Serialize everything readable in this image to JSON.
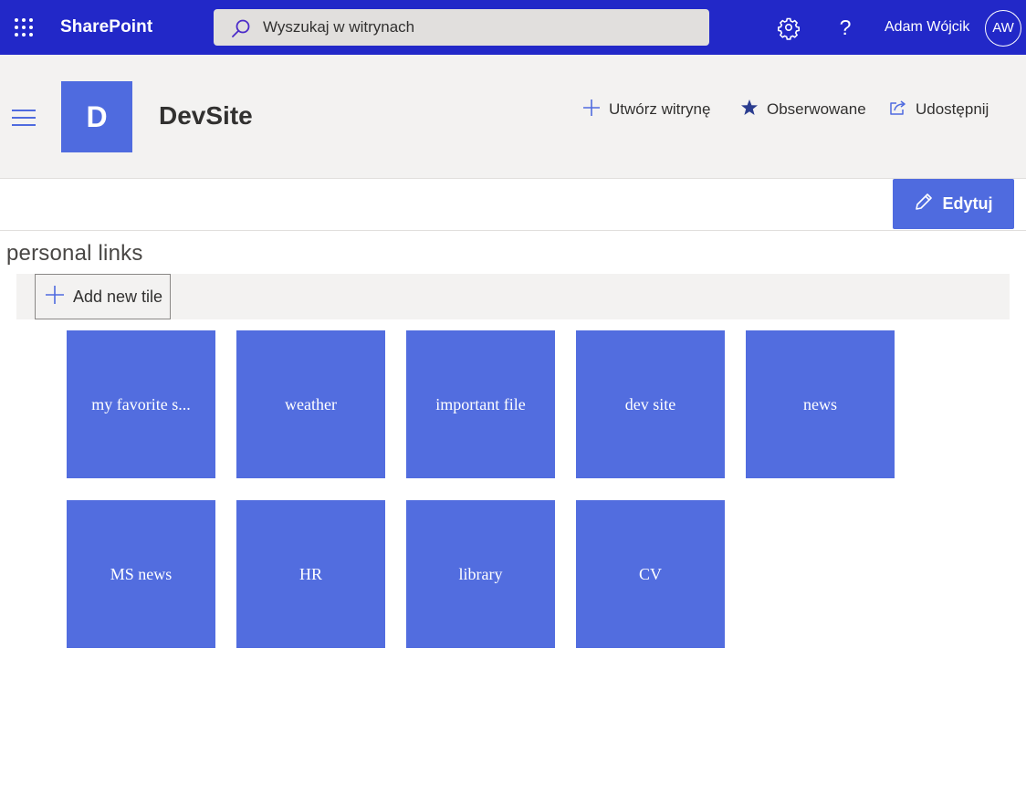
{
  "suitebar": {
    "brand": "SharePoint",
    "search_placeholder": "Wyszukaj w witrynach",
    "help_label": "?",
    "user_name": "Adam Wójcik",
    "user_initials": "AW"
  },
  "site": {
    "logo_letter": "D",
    "title": "DevSite",
    "actions": {
      "create": "Utwórz witrynę",
      "follow": "Obserwowane",
      "share": "Udostępnij"
    }
  },
  "commandbar": {
    "edit_label": "Edytuj"
  },
  "webpart": {
    "title": "personal links",
    "add_tile_label": "Add new tile",
    "tiles": [
      "my favorite s...",
      "weather",
      "important file",
      "dev site",
      "news",
      "MS news",
      "HR",
      "library",
      "CV"
    ]
  },
  "colors": {
    "suitebar": "#2228c8",
    "accent": "#4f6bdf",
    "tile": "#526ddf",
    "header_bg": "#f3f2f1"
  },
  "icons": {
    "waffle": "app-launcher-icon",
    "search": "search-icon",
    "gear": "gear-icon",
    "help": "help-icon",
    "menu": "hamburger-menu-icon",
    "add": "plus-icon",
    "follow": "star-icon",
    "share": "share-icon",
    "edit": "pencil-icon"
  }
}
